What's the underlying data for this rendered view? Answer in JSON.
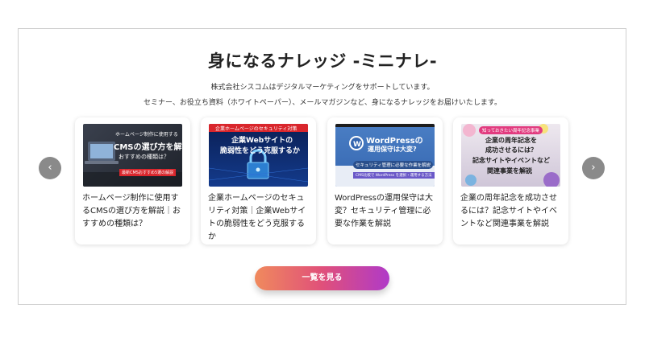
{
  "section": {
    "title": "身になるナレッジ -ミニナレ-",
    "description_line1": "株式会社シスコムはデジタルマーケティングをサポートしています。",
    "description_line2": "セミナー、お役立ち資料（ホワイトペーパー）、メールマガジンなど、身になるナレッジをお届けいたします。"
  },
  "carousel": {
    "prev_icon": "chevron-left-icon",
    "next_icon": "chevron-right-icon",
    "prev_glyph": "‹",
    "next_glyph": "›"
  },
  "cards": [
    {
      "title": "ホームページ制作に使用するCMSの選び方を解説｜おすすめの種類は？",
      "thumb": {
        "line1": "ホームページ制作に使用する",
        "line2": "CMSの選び方を解説",
        "line3": "おすすめの種類は？",
        "badge": "最新CMSおすすめ5選の解説",
        "bg": "#2a2f3a"
      }
    },
    {
      "title": "企業ホームページのセキュリティ対策｜企業Webサイトの脆弱性をどう克服するか",
      "thumb": {
        "header": "企業ホームページのセキュリティ対策",
        "line1": "企業Webサイトの",
        "line2": "脆弱性をどう克服するか",
        "bg": "#0d2a6e",
        "accent": "#d9262c"
      }
    },
    {
      "title": "WordPressの運用保守は大変？セキュリティ管理に必要な作業を解説",
      "thumb": {
        "line1": "WordPressの",
        "line2": "運用保守は大変?",
        "line3": "セキュリティ管理に必要な作業を解説",
        "badge": "CMS比較で WordPress を選択・運用する方法",
        "bg": "#3d6fb6"
      }
    },
    {
      "title": "企業の周年記念を成功させるには？記念サイトやイベントなど関連事業を解説",
      "thumb": {
        "header": "知っておきたい周年記念事業",
        "line1": "企業の周年記念を",
        "line2": "成功させるには？",
        "line3": "記念サイトやイベントなど",
        "line4": "関連事業を解説",
        "bg": "#e9e3ea",
        "accent": "#e23b7f"
      }
    }
  ],
  "cta": {
    "label": "一覧を見る"
  }
}
